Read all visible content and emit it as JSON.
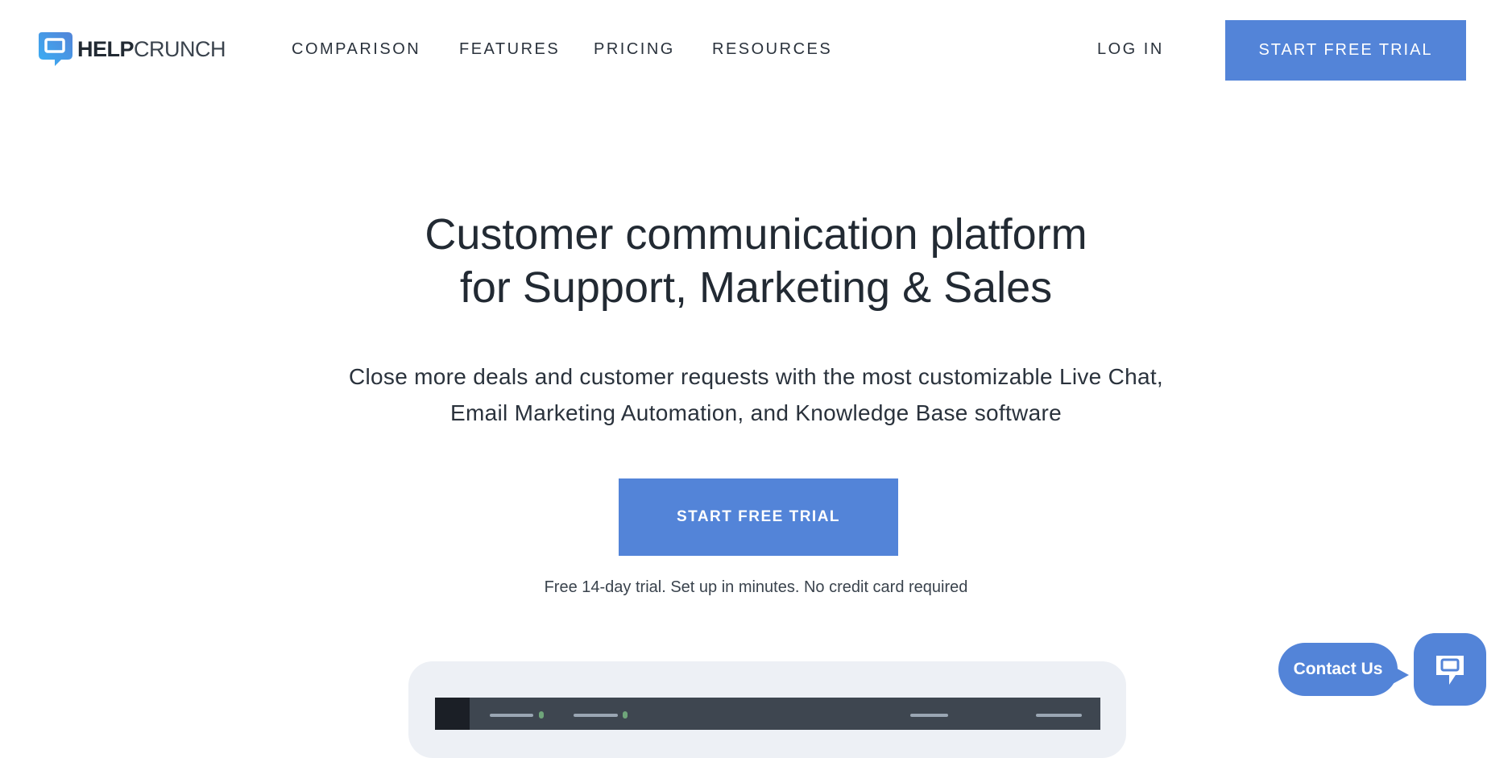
{
  "brand": {
    "name_bold": "HELP",
    "name_light": "CRUNCH",
    "accent": "#5384d8"
  },
  "nav": {
    "items": [
      "COMPARISON",
      "FEATURES",
      "PRICING",
      "RESOURCES"
    ],
    "login": "LOG IN",
    "cta": "START FREE TRIAL"
  },
  "hero": {
    "title_line1": "Customer communication platform",
    "title_line2": "for Support, Marketing & Sales",
    "subtitle_line1": "Close more deals and customer requests with the most customizable Live Chat,",
    "subtitle_line2": "Email Marketing Automation, and Knowledge Base software",
    "cta": "START FREE TRIAL",
    "note": "Free 14-day trial. Set up in minutes. No credit card required"
  },
  "widget": {
    "contact_label": "Contact Us",
    "icon": "chat-icon"
  }
}
